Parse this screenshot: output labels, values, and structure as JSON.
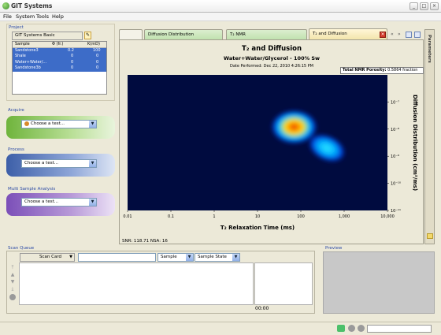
{
  "app": {
    "title": "GIT Systems"
  },
  "menu": [
    "File",
    "System",
    "Tools",
    "Help"
  ],
  "project": {
    "section_title": "Project",
    "name": "GIT Systems Basic",
    "columns": [
      "Sample",
      "Φ (fr.)",
      "K(mD)"
    ],
    "rows": [
      {
        "sample": "Sandstone3",
        "phi": "0.2",
        "k": "100",
        "selected": true
      },
      {
        "sample": "Shale",
        "phi": "0",
        "k": "0",
        "selected": true
      },
      {
        "sample": "Water+Water/...",
        "phi": "0",
        "k": "0",
        "selected": true
      },
      {
        "sample": "Sandstone3b",
        "phi": "0",
        "k": "0",
        "selected": true
      }
    ]
  },
  "acquire": {
    "title": "Acquire",
    "placeholder": "Choose a test...",
    "accent": "#6fb43c"
  },
  "process": {
    "title": "Process",
    "placeholder": "Choose a test...",
    "accent": "#3d5fa8"
  },
  "multi": {
    "title": "Multi Sample Analysis",
    "placeholder": "Choose a test...",
    "accent": "#7b4fb8"
  },
  "tabs": [
    {
      "label": "",
      "active": false
    },
    {
      "label": "Diffusion Distribution",
      "active": false
    },
    {
      "label": "T₂ NMR",
      "active": false
    },
    {
      "label": "T₂ and Diffusion",
      "active": true
    }
  ],
  "chart": {
    "title": "T₂ and Diffusion",
    "subtitle": "Water+Water/Glycerol - 100% Sw",
    "date": "Date Performed: Dec 22, 2010 4:26:15 PM",
    "porosity_label": "Total NMR Porosity:",
    "porosity_value": "0.5864 fraction",
    "snr": "SNR: 118.71 NSA: 16",
    "side_label": "Parameters"
  },
  "chart_data": {
    "type": "heatmap",
    "title": "T₂ and Diffusion",
    "subtitle": "Water+Water/Glycerol - 100% Sw",
    "xlabel": "T₂ Relaxation Time (ms)",
    "ylabel": "Diffusion Distribution (cm²/ms)",
    "x_scale": "log",
    "y_scale": "log",
    "xlim": [
      0.01,
      10000
    ],
    "ylim": [
      1e-11,
      1e-06
    ],
    "x_ticks": [
      "0.01",
      "0.1",
      "1",
      "10",
      "100",
      "1,000",
      "10,000"
    ],
    "y_ticks": [
      "10⁻⁷",
      "10⁻⁸",
      "10⁻⁹",
      "10⁻¹⁰",
      "10⁻¹¹"
    ],
    "peaks": [
      {
        "t2_ms": 70,
        "diffusion": 1.2e-08,
        "intensity": 1.0
      },
      {
        "t2_ms": 400,
        "diffusion": 2e-09,
        "intensity": 0.7
      }
    ],
    "colormap": [
      "#000b3f",
      "#0030d0",
      "#00c8ff",
      "#ffe000",
      "#e02000"
    ]
  },
  "queue": {
    "title": "Scan Queue",
    "scan_card": "Scan Card",
    "sample": "Sample",
    "sample_state": "Sample State",
    "time": "00:00"
  },
  "preview": {
    "title": "Preview"
  }
}
